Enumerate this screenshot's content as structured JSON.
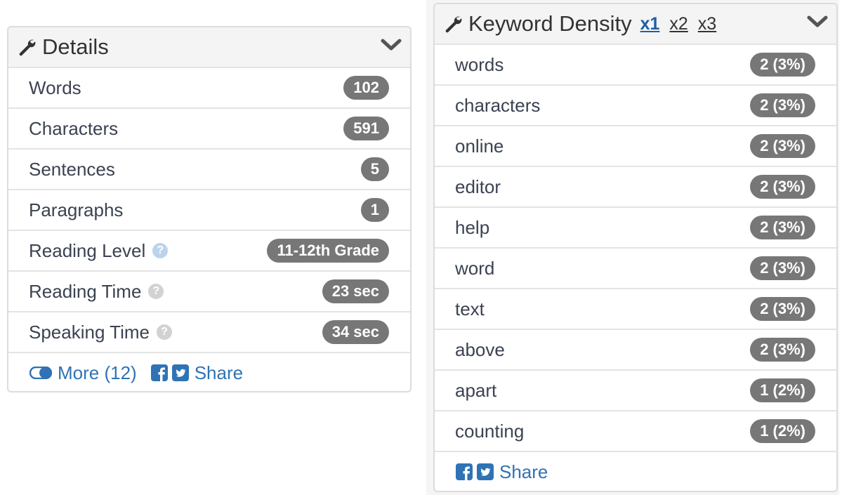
{
  "details": {
    "title": "Details",
    "rows": [
      {
        "label": "Words",
        "value": "102"
      },
      {
        "label": "Characters",
        "value": "591"
      },
      {
        "label": "Sentences",
        "value": "5"
      },
      {
        "label": "Paragraphs",
        "value": "1"
      },
      {
        "label": "Reading Level",
        "value": "11-12th Grade",
        "help": "?"
      },
      {
        "label": "Reading Time",
        "value": "23 sec",
        "help": "?"
      },
      {
        "label": "Speaking Time",
        "value": "34 sec",
        "help": "?"
      }
    ],
    "more_label": "More (12)",
    "share_label": "Share"
  },
  "keyword_density": {
    "title": "Keyword Density",
    "granularity": [
      "x1",
      "x2",
      "x3"
    ],
    "selected_granularity": "x1",
    "rows": [
      {
        "word": "words",
        "value": "2 (3%)"
      },
      {
        "word": "characters",
        "value": "2 (3%)"
      },
      {
        "word": "online",
        "value": "2 (3%)"
      },
      {
        "word": "editor",
        "value": "2 (3%)"
      },
      {
        "word": "help",
        "value": "2 (3%)"
      },
      {
        "word": "word",
        "value": "2 (3%)"
      },
      {
        "word": "text",
        "value": "2 (3%)"
      },
      {
        "word": "above",
        "value": "2 (3%)"
      },
      {
        "word": "apart",
        "value": "1 (2%)"
      },
      {
        "word": "counting",
        "value": "1 (2%)"
      }
    ],
    "share_label": "Share"
  },
  "icons": {
    "header": "wrench-icon",
    "collapse": "chevron-down-icon",
    "more": "toggle-icon",
    "facebook": "facebook-icon",
    "twitter": "twitter-icon"
  },
  "colors": {
    "badge": "#777777",
    "link": "#2f73b5",
    "active_tab": "#1d5ea8",
    "help_reading_level": "#bcd3ec",
    "help_default": "#d2d2d2"
  }
}
